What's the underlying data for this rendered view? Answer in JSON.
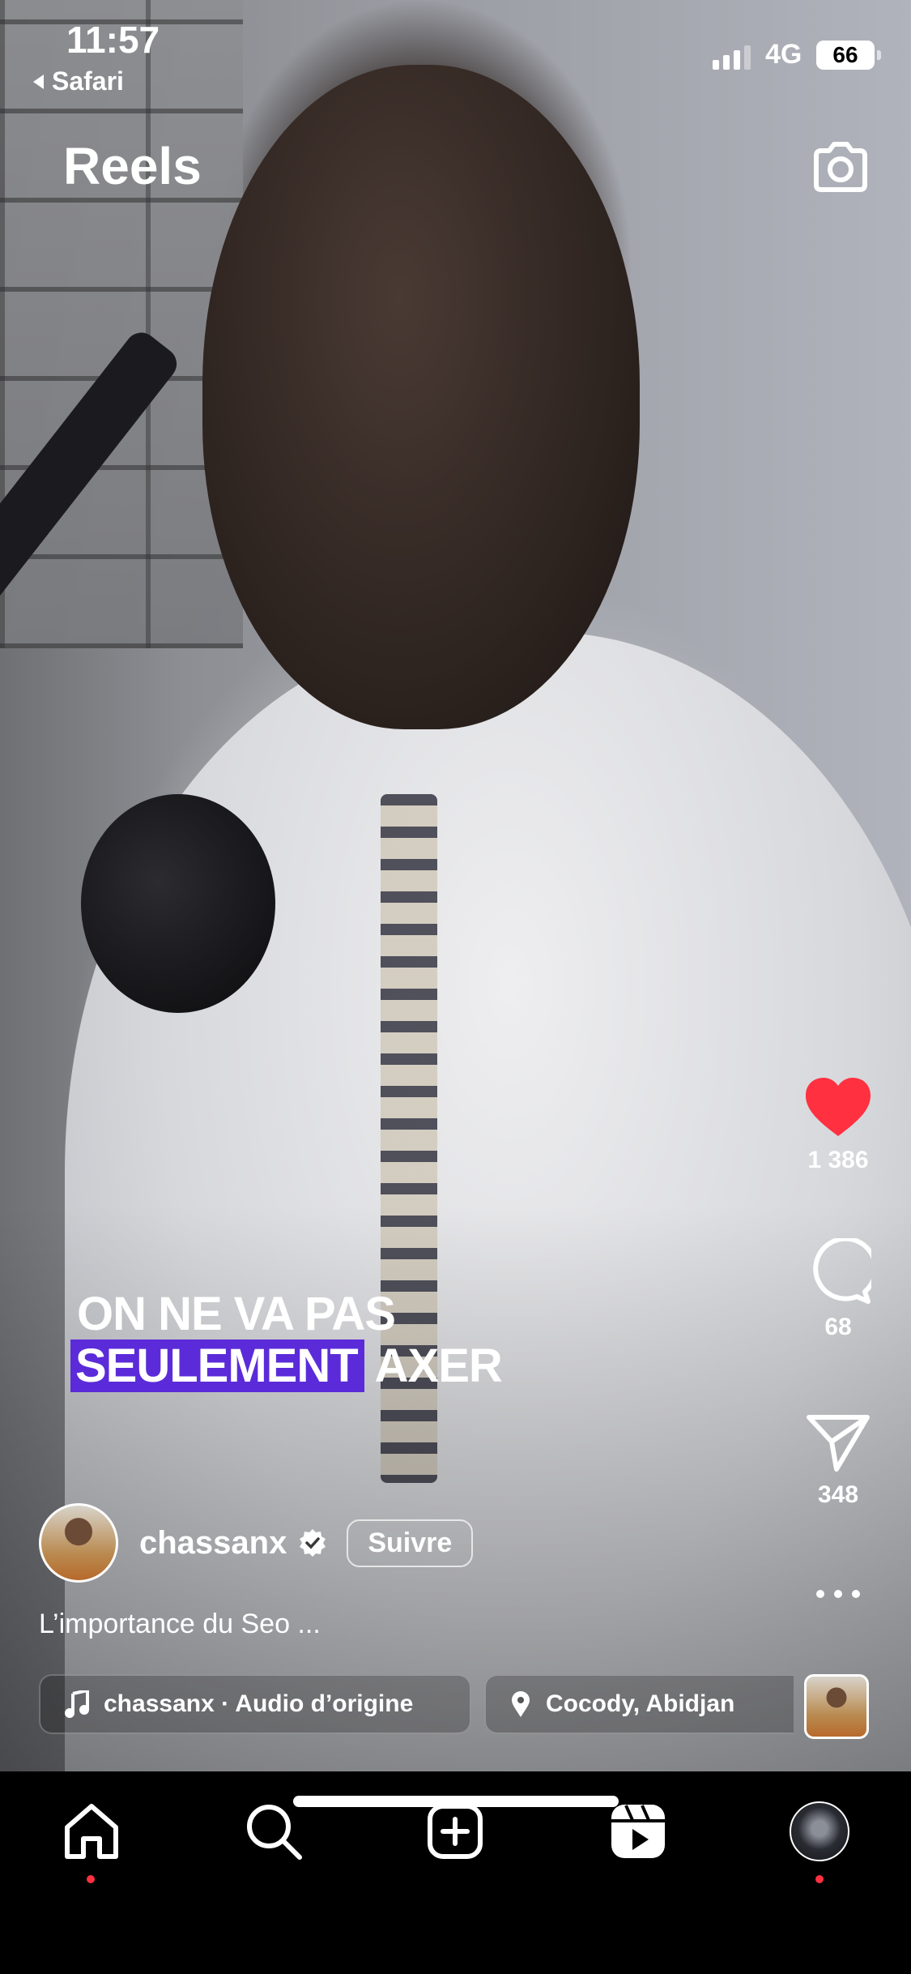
{
  "status_bar": {
    "time": "11:57",
    "back_app": "Safari",
    "network": "4G",
    "battery": "66"
  },
  "header": {
    "title": "Reels",
    "camera_icon": "camera-icon"
  },
  "video": {
    "caption_line1": "ON NE VA PAS",
    "caption_highlight": "SEULEMENT",
    "caption_rest": "AXER"
  },
  "actions": {
    "likes": "1 386",
    "comments": "68",
    "shares": "348",
    "like_color": "#ff3040"
  },
  "post": {
    "username": "chassanx",
    "follow_label": "Suivre",
    "description": "L’importance du Seo ...",
    "audio": "chassanx · Audio d’origine",
    "location": "Cocody, Abidjan"
  },
  "tabbar": {
    "items": [
      "home-icon",
      "search-icon",
      "create-icon",
      "reels-icon",
      "profile-avatar"
    ]
  }
}
